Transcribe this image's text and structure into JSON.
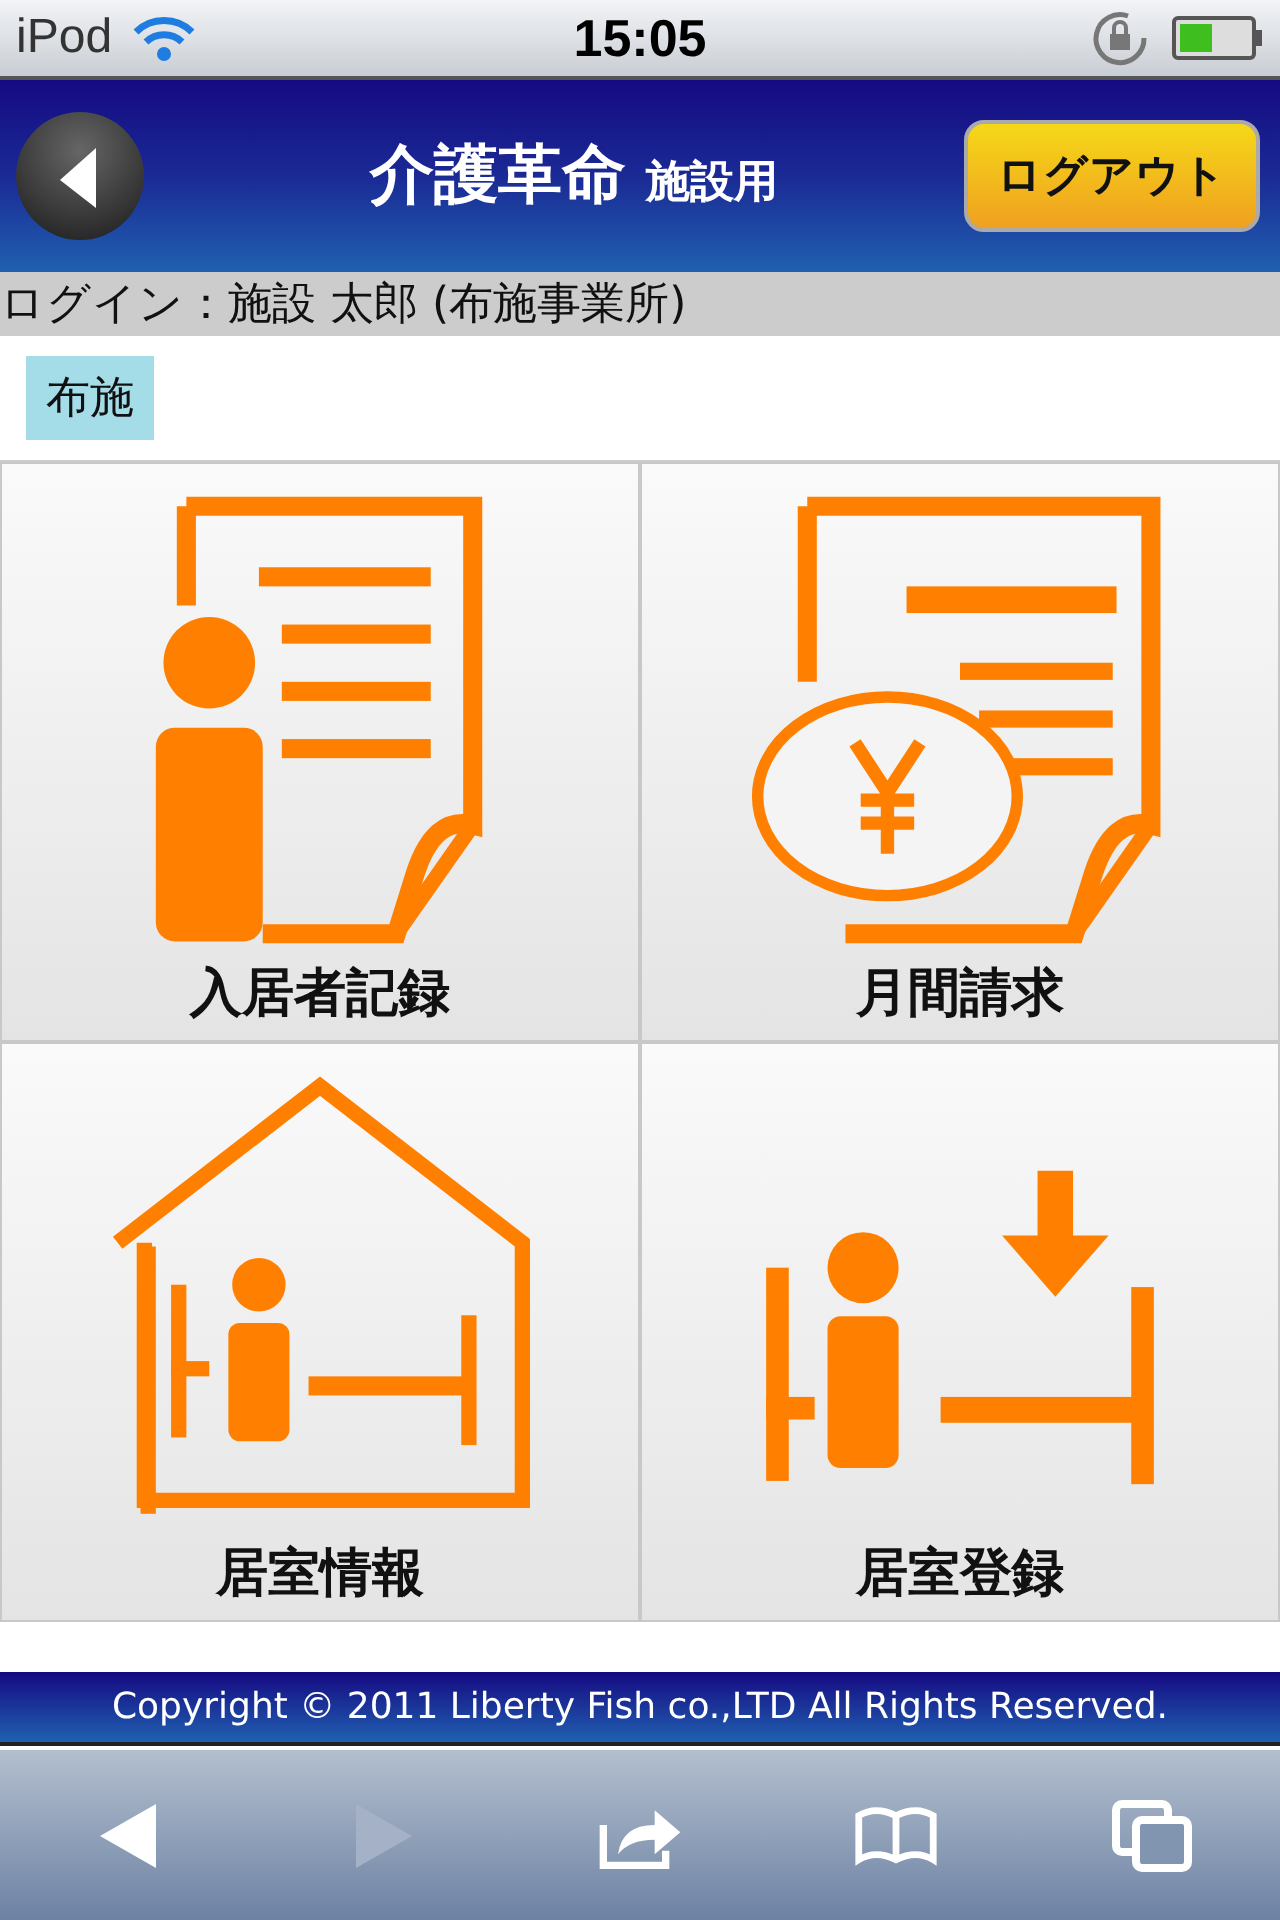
{
  "status_bar": {
    "carrier": "iPod",
    "time": "15:05"
  },
  "header": {
    "title": "介護革命",
    "subtitle": "施設用",
    "logout_button": "ログアウト"
  },
  "login_info": "ログイン：施設 太郎 (布施事業所)",
  "office_tag": "布施",
  "menu_tiles": [
    {
      "kind": "resident",
      "label": "入居者記録"
    },
    {
      "kind": "billing",
      "label": "月間請求"
    },
    {
      "kind": "room",
      "label": "居室情報"
    },
    {
      "kind": "room-register",
      "label": "居室登録"
    }
  ],
  "footer": "Copyright © 2011 Liberty Fish co.,LTD All Rights Reserved.",
  "browser_toolbar": [
    {
      "kind": "back",
      "disabled": false
    },
    {
      "kind": "forward",
      "disabled": true
    },
    {
      "kind": "share",
      "disabled": false
    },
    {
      "kind": "bookmarks",
      "disabled": false
    },
    {
      "kind": "pages",
      "disabled": false
    }
  ]
}
